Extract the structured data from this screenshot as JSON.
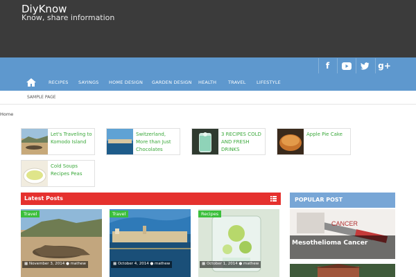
{
  "site": {
    "title": "DiyKnow",
    "tagline": "Know, share information"
  },
  "social": [
    {
      "icon": "facebook-icon",
      "glyph": "f"
    },
    {
      "icon": "youtube-icon",
      "glyph": "▶"
    },
    {
      "icon": "twitter-icon",
      "glyph": "t"
    },
    {
      "icon": "google-plus-icon",
      "glyph": "g+"
    }
  ],
  "nav": {
    "home_icon": "home-icon",
    "items": [
      "RECIPES",
      "SAYINGS",
      "HOME DESIGN",
      "GARDEN DESIGN",
      "HEALTH",
      "TRAVEL",
      "LIFESTYLE"
    ]
  },
  "subnav": {
    "items": [
      "SAMPLE PAGE"
    ]
  },
  "breadcrumb": "Home",
  "related": [
    {
      "title": "Let's Traveling to Komodo Island"
    },
    {
      "title": "Switzerland, More than Just Chocolates"
    },
    {
      "title": "3 RECIPES COLD AND FRESH DRINKS"
    },
    {
      "title": "Apple Pie Cake"
    },
    {
      "title": "Cold Soups Recipes Peas"
    }
  ],
  "latest": {
    "title": "Latest Posts",
    "posts": [
      {
        "category": "Travel",
        "date": "November 3, 2014",
        "author": "mathew"
      },
      {
        "category": "Travel",
        "date": "October 4, 2014",
        "author": "mathew"
      },
      {
        "category": "Recipes",
        "date": "October 1, 2014",
        "author": "mathew"
      }
    ]
  },
  "popular": {
    "title": "POPULAR POST",
    "items": [
      {
        "title": "Mesothelioma Cancer"
      }
    ]
  },
  "colors": {
    "header": "#3b3b3b",
    "nav": "#5e98ce",
    "accent_green": "#3aa83a",
    "latest_bar": "#e5312e",
    "popular_bar": "#78a6d6"
  }
}
